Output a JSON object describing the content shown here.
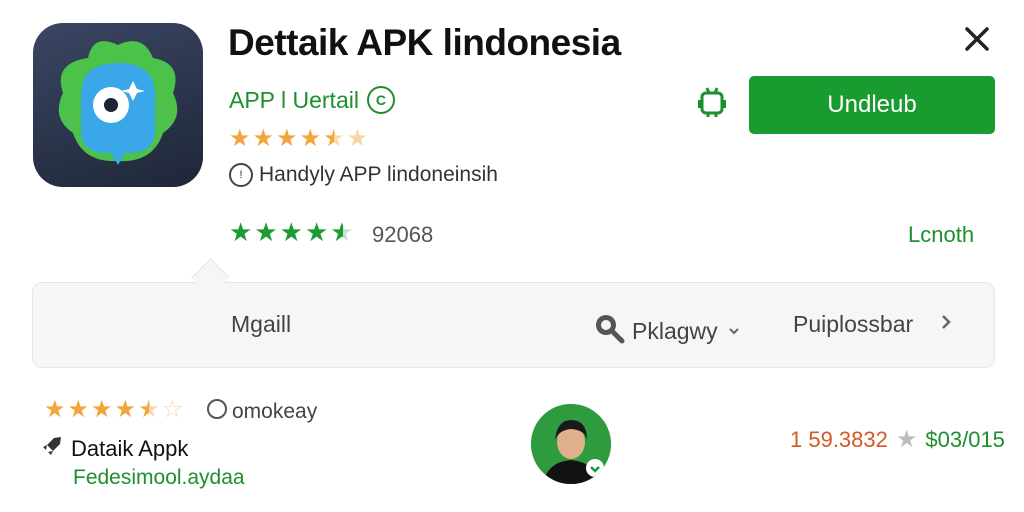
{
  "app": {
    "title": "Dettaik APK lindonesia",
    "developer": "APP l Uertail",
    "developer_badge": "C",
    "rating_top": 4.5,
    "tagline": "Handyly APP lindoneinsih",
    "tagline_icon": "!",
    "rating_green": 4.5,
    "rating_count": "92068",
    "length_label": "Lcnoth",
    "install_label": "Undleub"
  },
  "filter_bar": {
    "left_label": "Mgaill",
    "search_label": "Pklagwy",
    "right_label": "Puiplossbar"
  },
  "bottom": {
    "rating": 4.5,
    "meta_text": "omokeay",
    "title": "Dataik Appk",
    "subtitle": "Fedesimool.aydaa",
    "price1": "1 59.3832",
    "price2": "$03/015"
  },
  "colors": {
    "accent_green": "#1a9b30",
    "star_orange": "#f2a53b",
    "price_orange": "#d35a23"
  },
  "icons": [
    "app-icon",
    "close-icon",
    "android-robot-icon",
    "search-icon",
    "chevron-down-icon",
    "chevron-right-icon",
    "info-icon",
    "rocket-icon",
    "star-icon"
  ]
}
